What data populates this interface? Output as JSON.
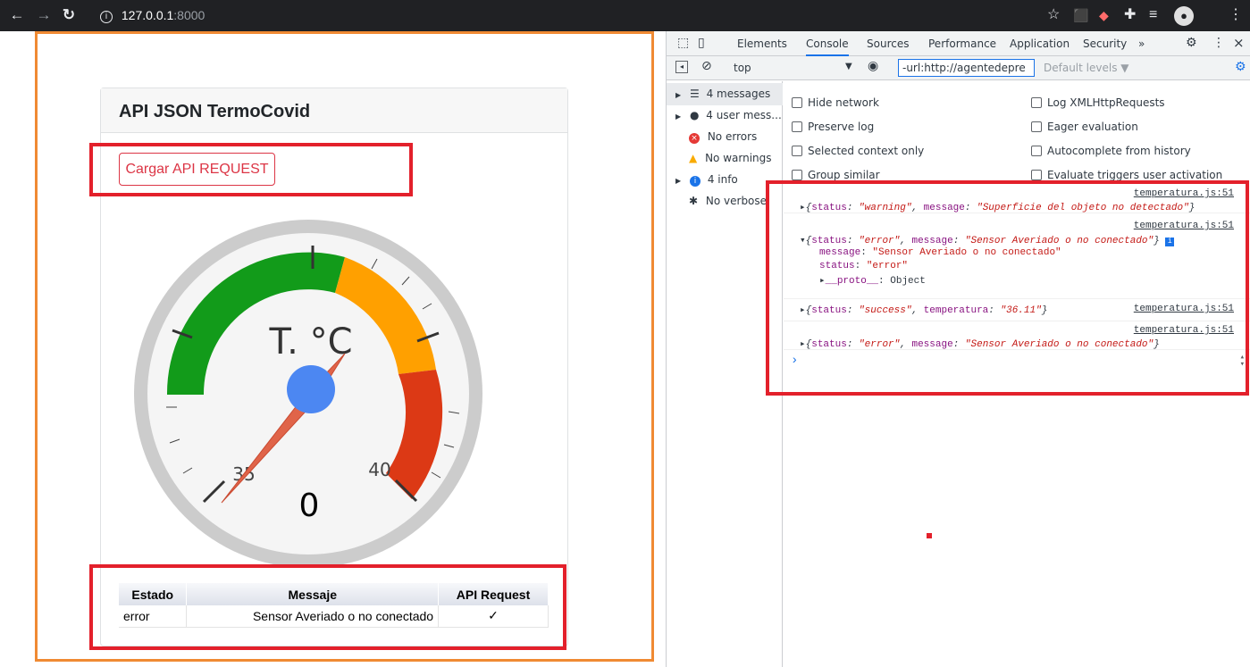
{
  "browser": {
    "url_host": "127.0.0.1",
    "url_port": ":8000",
    "back_icon": "arrow-left-icon",
    "forward_icon": "arrow-right-icon",
    "reload_icon": "reload-icon",
    "info_icon": "info-icon"
  },
  "page": {
    "card_title": "API JSON TermoCovid",
    "button_label": "Cargar API REQUEST",
    "gauge": {
      "label": "T. °C",
      "value_display": "0",
      "tick_35": "35",
      "tick_40": "40",
      "needle_value": "36.11"
    },
    "table": {
      "headers": [
        "Estado",
        "Messaje",
        "API Request"
      ],
      "rows": [
        {
          "estado": "error",
          "mensaje": "Sensor Averiado o no conectado",
          "api_request": "✓"
        }
      ]
    }
  },
  "devtools": {
    "tabs": [
      "Elements",
      "Console",
      "Sources",
      "Performance",
      "Application",
      "Security",
      "»"
    ],
    "active_tab": "Console",
    "context": "top",
    "filter": "-url:http://agentedepre",
    "levels": "Default levels ▼",
    "sidebar": [
      {
        "label": "4 messages",
        "icon": "list-icon"
      },
      {
        "label": "4 user mess...",
        "icon": "user-icon"
      },
      {
        "label": "No errors",
        "icon": "error-icon"
      },
      {
        "label": "No warnings",
        "icon": "warning-icon"
      },
      {
        "label": "4 info",
        "icon": "info-icon"
      },
      {
        "label": "No verbose",
        "icon": "bug-icon"
      }
    ],
    "settings": [
      "Hide network",
      "Log XMLHttpRequests",
      "Preserve log",
      "Eager evaluation",
      "Selected context only",
      "Autocomplete from history",
      "Group similar",
      "Evaluate triggers user activation"
    ],
    "console_source": "temperatura.js:51",
    "messages": {
      "m1": {
        "status": "\"warning\"",
        "message": "\"Superficie del objeto no detectado\""
      },
      "m2": {
        "status": "\"error\"",
        "message": "\"Sensor Averiado o no conectado\"",
        "expanded_message": "\"Sensor Averiado o no conectado\"",
        "expanded_status": "\"error\"",
        "proto": "Object"
      },
      "m3": {
        "status": "\"success\"",
        "temperatura": "\"36.11\""
      },
      "m4": {
        "status": "\"error\"",
        "message": "\"Sensor Averiado o no conectado\""
      }
    },
    "prompt": "›"
  },
  "colors": {
    "brand_green": "#129b1a",
    "brand_orange": "#ffa000",
    "brand_red": "#dc3915",
    "needle": "#e06449",
    "annotation_red": "#e3202b",
    "page_frame_orange": "#f08a33"
  }
}
